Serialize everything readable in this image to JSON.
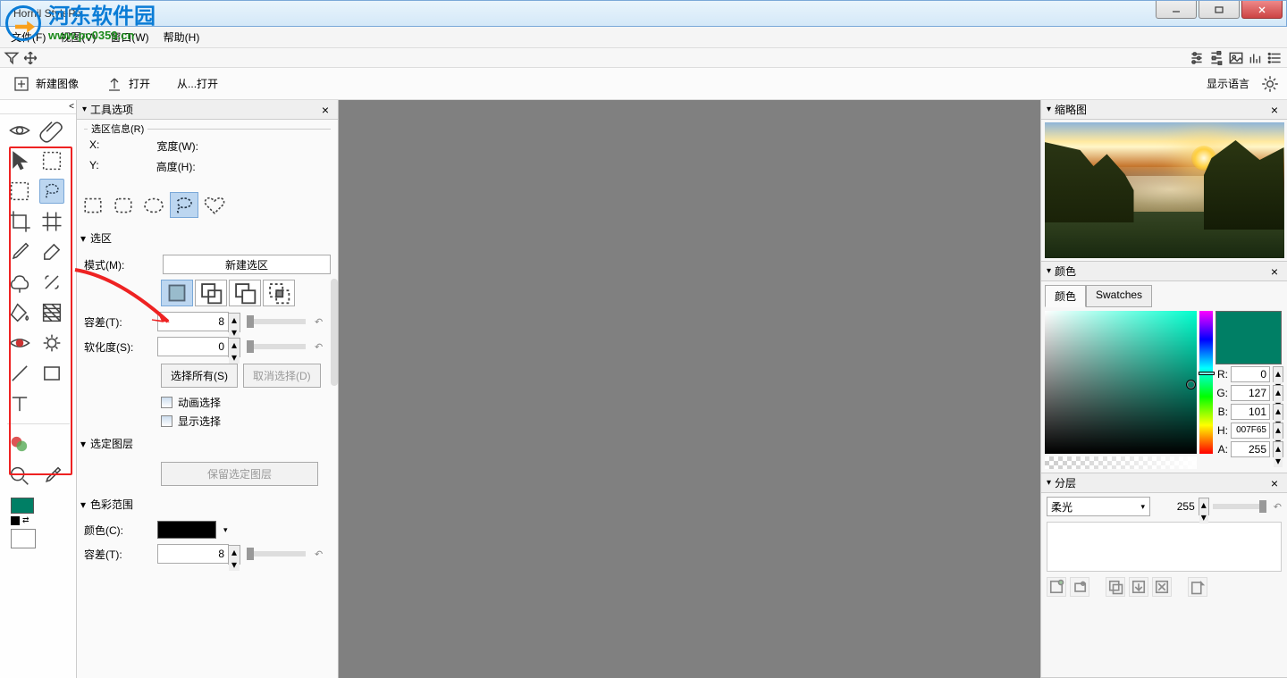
{
  "window": {
    "title": "Hornil StylePix"
  },
  "watermark": {
    "text": "河东软件园",
    "url": "www.pc0359.cn"
  },
  "menu": {
    "file": "文件(F)",
    "view": "视图(V)",
    "window": "窗口(W)",
    "help": "帮助(H)"
  },
  "actions": {
    "new_image": "新建图像",
    "open": "打开",
    "open_from": "从...打开",
    "display_language": "显示语言"
  },
  "panels": {
    "tool_options": "工具选项",
    "thumb": "缩略图",
    "color": "颜色",
    "layers": "分层"
  },
  "tool_options": {
    "selection_info": {
      "legend": "选区信息(R)",
      "x": "X:",
      "y": "Y:",
      "width": "宽度(W):",
      "height": "高度(H):"
    },
    "section_selection": "选区",
    "mode_label": "模式(M):",
    "mode_value": "新建选区",
    "tolerance_label": "容差(T):",
    "tolerance_value": "8",
    "softness_label": "软化度(S):",
    "softness_value": "0",
    "select_all": "选择所有(S)",
    "deselect": "取消选择(D)",
    "anim_select": "动画选择",
    "show_select": "显示选择",
    "section_selected_layer": "选定图层",
    "keep_selected_layer": "保留选定图层",
    "section_color_range": "色彩范围",
    "color_label": "颜色(C):",
    "tolerance2_value": "8"
  },
  "color_panel": {
    "tab_color": "颜色",
    "tab_swatches": "Swatches",
    "r_lbl": "R:",
    "r": "0",
    "g_lbl": "G:",
    "g": "127",
    "b_lbl": "B:",
    "b": "101",
    "h_lbl": "H:",
    "h": "007F65",
    "a_lbl": "A:",
    "a": "255",
    "current_hex": "#007F65"
  },
  "layers": {
    "blend_mode": "柔光",
    "opacity": "255"
  }
}
